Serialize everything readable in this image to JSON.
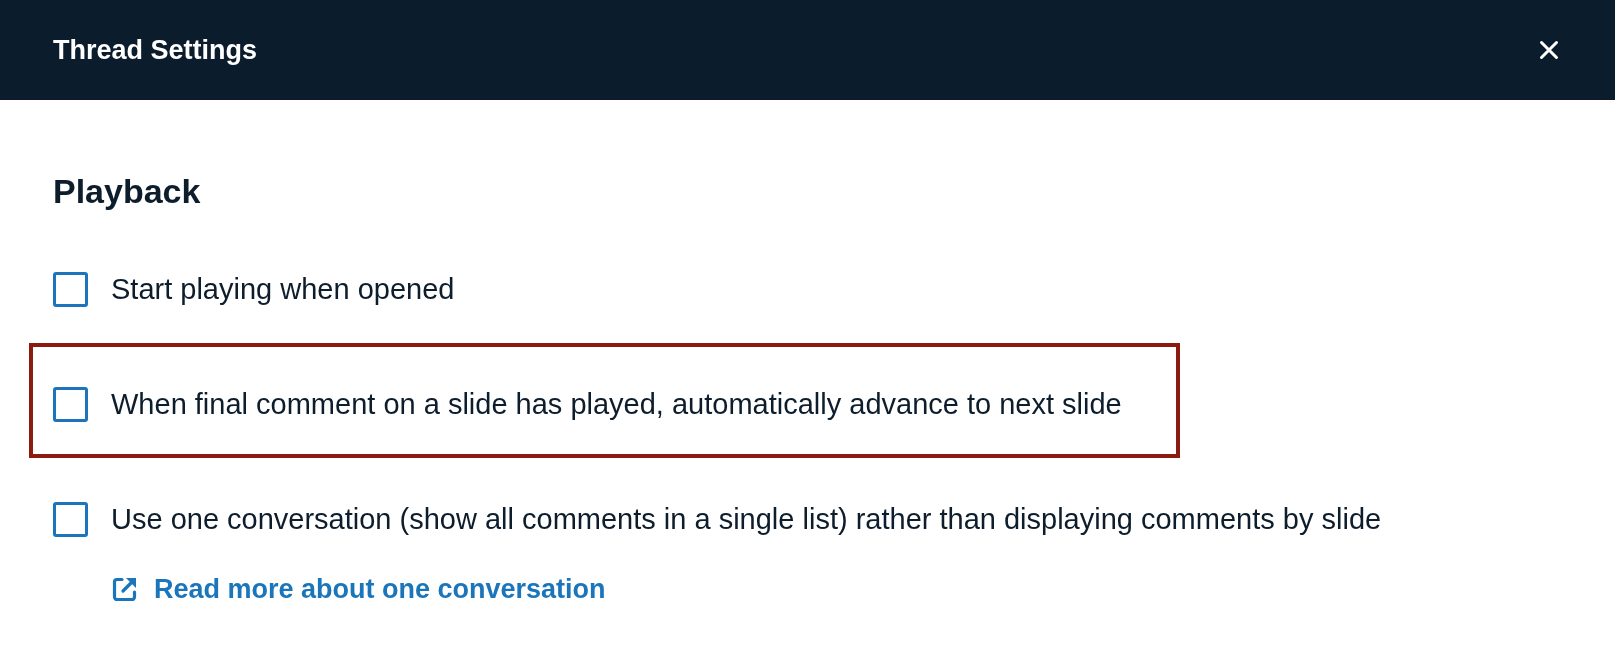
{
  "header": {
    "title": "Thread Settings"
  },
  "section": {
    "heading": "Playback",
    "options": [
      {
        "label": "Start playing when opened",
        "checked": false,
        "highlighted": false
      },
      {
        "label": "When final comment on a slide has played, automatically advance to next slide",
        "checked": false,
        "highlighted": true
      },
      {
        "label": "Use one conversation (show all comments in a single list) rather than displaying comments by slide",
        "checked": false,
        "highlighted": false,
        "link": "Read more about one conversation"
      }
    ]
  }
}
